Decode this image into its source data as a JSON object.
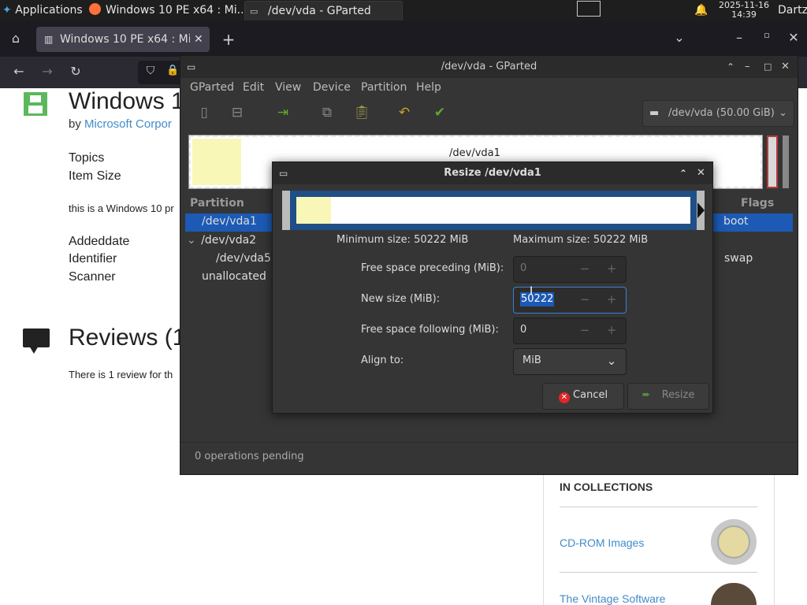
{
  "taskbar": {
    "apps_label": "Applications",
    "windows": [
      {
        "label": "Windows 10 PE x64 : Mi..."
      },
      {
        "label": "/dev/vda - GParted"
      }
    ],
    "clock_date": "2025-11-16",
    "clock_time": "14:39",
    "user": "Dartz"
  },
  "browser": {
    "tab_title": "Windows 10 PE x64 : Mic"
  },
  "webpage": {
    "title": "Windows 1",
    "by_prefix": "by",
    "author": "Microsoft Corpor",
    "meta_labels": [
      "Topics",
      "Item Size"
    ],
    "description": "this is a Windows 10 pr",
    "meta_labels2": [
      "Addeddate",
      "Identifier",
      "Scanner"
    ],
    "reviews_heading": "Reviews (1",
    "reviews_text": "There is 1 review for th",
    "collections_heading": "IN COLLECTIONS",
    "collections": [
      "CD-ROM Images",
      "The Vintage Software"
    ]
  },
  "gparted": {
    "title": "/dev/vda - GParted",
    "menu": [
      "GParted",
      "Edit",
      "View",
      "Device",
      "Partition",
      "Help"
    ],
    "disk_select": "/dev/vda (50.00 GiB)",
    "graph_label": "/dev/vda1",
    "col_partition": "Partition",
    "col_flags": "Flags",
    "partitions": [
      {
        "name": "/dev/vda1",
        "flags": "boot"
      },
      {
        "name": "/dev/vda2",
        "flags": ""
      },
      {
        "name": "/dev/vda5",
        "flags": "swap"
      },
      {
        "name": "unallocated",
        "flags": ""
      }
    ],
    "status": "0 operations pending"
  },
  "dialog": {
    "title": "Resize /dev/vda1",
    "min_size": "Minimum size: 50222 MiB",
    "max_size": "Maximum size: 50222 MiB",
    "free_preceding_label": "Free space preceding (MiB):",
    "free_preceding_value": "0",
    "new_size_label": "New size (MiB):",
    "new_size_value": "50222",
    "free_following_label": "Free space following (MiB):",
    "free_following_value": "0",
    "align_label": "Align to:",
    "align_value": "MiB",
    "cancel_label": "Cancel",
    "resize_label": "Resize"
  },
  "colors": {
    "selection": "#1c5ab5",
    "partition_fill": "#f8f7b8",
    "cancel_icon": "#e0262a",
    "apply_icon": "#5fa82e"
  }
}
